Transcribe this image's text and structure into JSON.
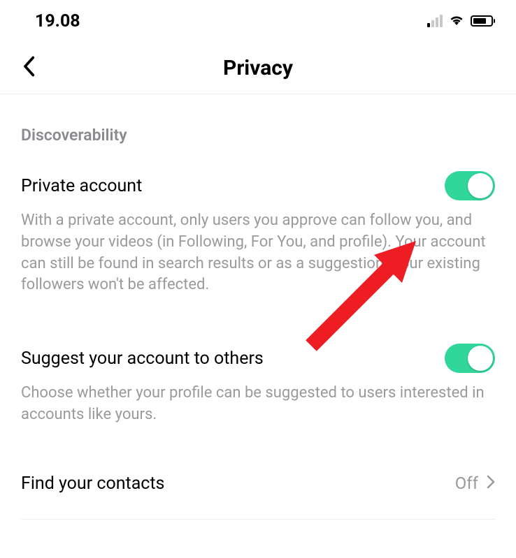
{
  "status": {
    "time": "19.08"
  },
  "nav": {
    "title": "Privacy"
  },
  "section": {
    "header": "Discoverability"
  },
  "privateAccount": {
    "title": "Private account",
    "desc": "With a private account, only users you approve can follow you, and browse your videos (in Following, For You, and profile). Your account can still be found in search results or as a suggestion. Your existing followers won't be affected.",
    "enabled": true
  },
  "suggest": {
    "title": "Suggest your account to others",
    "desc": "Choose whether your profile can be suggested to users interested in accounts like yours.",
    "enabled": true
  },
  "findContacts": {
    "title": "Find your contacts",
    "value": "Off"
  }
}
